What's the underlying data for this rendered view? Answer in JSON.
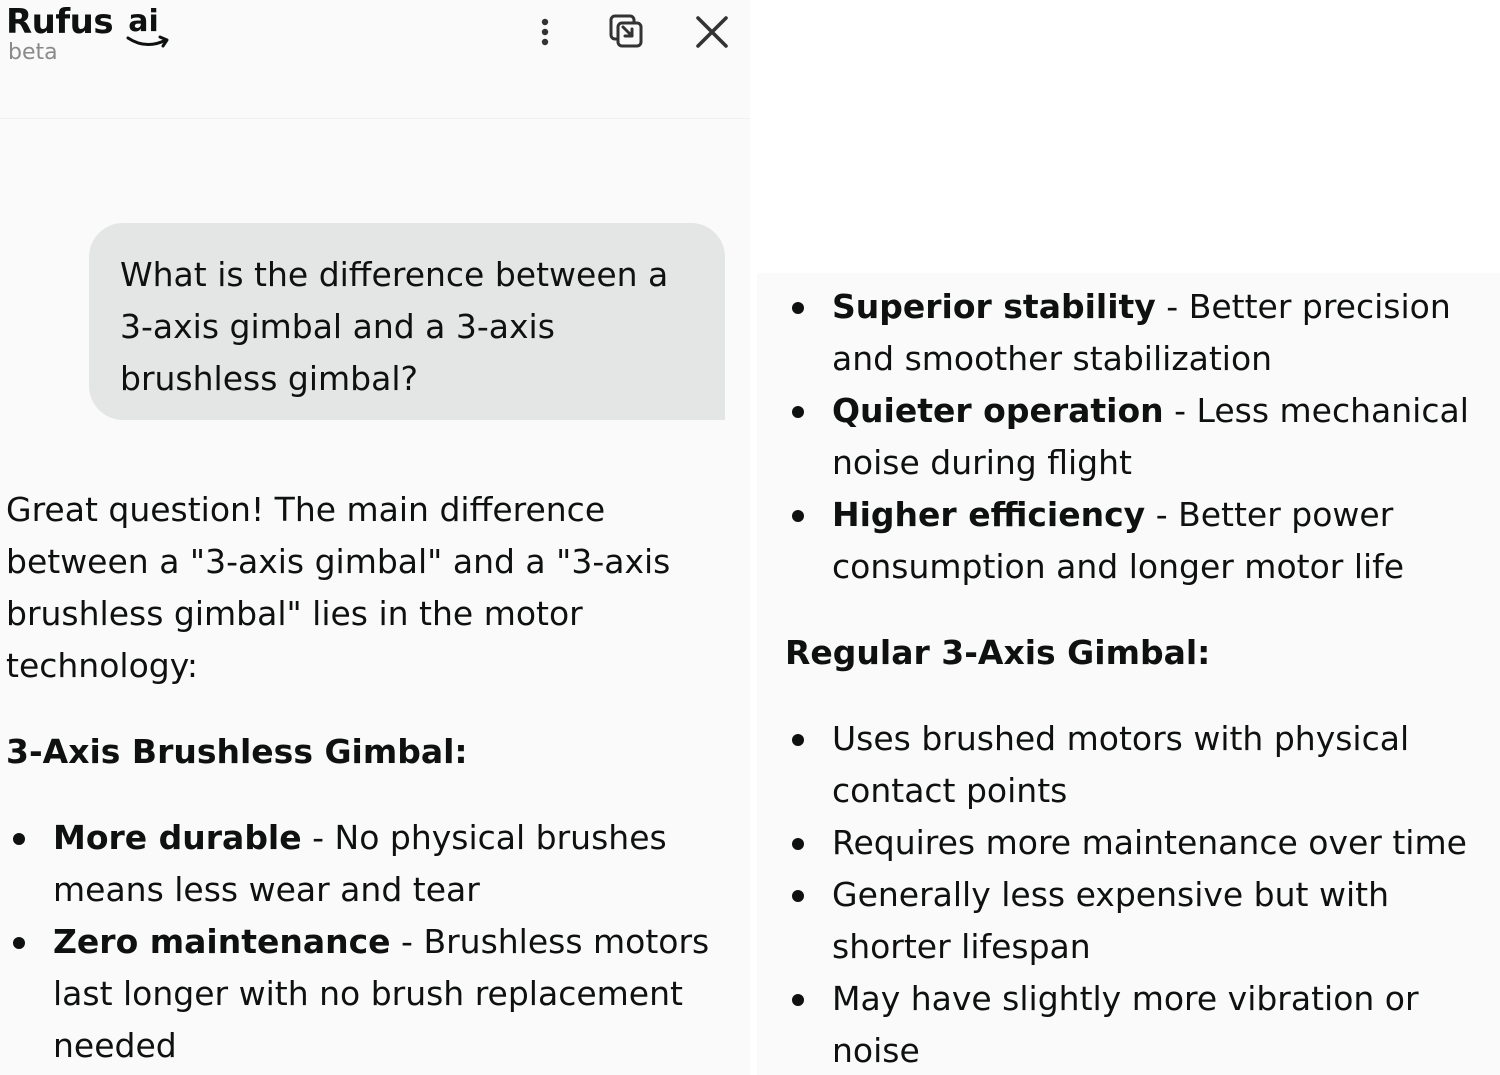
{
  "header": {
    "brand_name": "Rufus",
    "brand_ai": "ai",
    "brand_tag": "beta",
    "icons": [
      "more-options-icon",
      "popout-icon",
      "close-icon"
    ]
  },
  "conversation": {
    "user_message": "What is the difference between a 3-axis gimbal and a 3-axis brushless gimbal?",
    "intro": "Great question! The main difference between a \"3-axis gimbal\" and a \"3-axis brushless gimbal\" lies in the motor technology:",
    "brushless_heading": "3-Axis Brushless Gimbal:",
    "brushless_points": [
      {
        "title": "More durable",
        "text": " - No physical brushes means less wear and tear"
      },
      {
        "title": "Zero maintenance",
        "text": " - Brushless motors last longer with no brush replacement needed"
      }
    ],
    "brushless_points_continued": [
      {
        "title": "Superior stability",
        "text": " - Better precision and smoother stabilization"
      },
      {
        "title": "Quieter operation",
        "text": " - Less mechanical noise during flight"
      },
      {
        "title": "Higher efficiency",
        "text": " - Better power consumption and longer motor life"
      }
    ],
    "regular_heading": "Regular 3-Axis Gimbal:",
    "regular_points": [
      "Uses brushed motors with physical contact points",
      "Requires more maintenance over time",
      "Generally less expensive but with shorter lifespan",
      "May have slightly more vibration or noise"
    ]
  }
}
